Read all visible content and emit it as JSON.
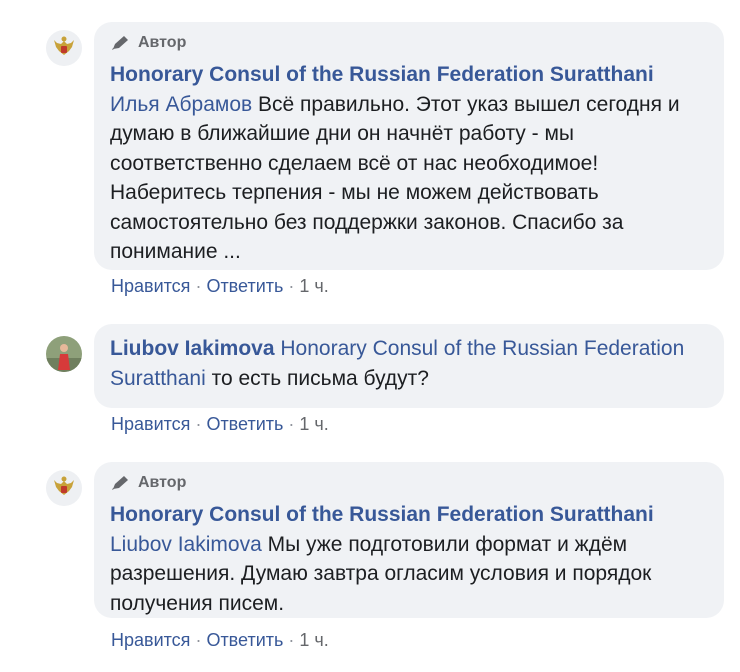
{
  "comments": [
    {
      "avatar_icon": "russian-coat-of-arms-icon",
      "badge": "Автор",
      "author": "Honorary Consul of the Russian Federation Suratthani",
      "mention": "Илья Абрамов",
      "text": "Всё правильно. Этот указ вышел сегодня и думаю в ближайшие дни он начнёт работу - мы соответственно сделаем всё от нас необходимое! Наберитесь терпения - мы не можем действовать самостоятельно без поддержки законов. Спасибо за понимание ...",
      "like": "Нравится",
      "reply": "Ответить",
      "time": "1 ч."
    },
    {
      "avatar_icon": "user-photo-avatar",
      "author": "Liubov Iakimova",
      "mention": "Honorary Consul of the Russian Federation Suratthani",
      "text": "то есть письма будут?",
      "like": "Нравится",
      "reply": "Ответить",
      "time": "1 ч."
    },
    {
      "avatar_icon": "russian-coat-of-arms-icon",
      "badge": "Автор",
      "author": "Honorary Consul of the Russian Federation Suratthani",
      "mention": "Liubov Iakimova",
      "text": "Мы уже подготовили формат и ждём разрешения. Думаю завтра огласим условия и порядок получения писем.",
      "like": "Нравится",
      "reply": "Ответить",
      "time": "1 ч."
    }
  ],
  "colors": {
    "link": "#385898",
    "bubble": "#f0f2f5",
    "muted": "#65676b"
  }
}
